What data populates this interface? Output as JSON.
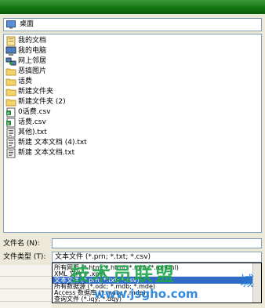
{
  "look_in": {
    "value": "桌面",
    "icon": "desktop-icon"
  },
  "files": [
    {
      "label": "我的文档",
      "icon": "my-documents-icon"
    },
    {
      "label": "我的电脑",
      "icon": "my-computer-icon"
    },
    {
      "label": "网上邻居",
      "icon": "network-icon"
    },
    {
      "label": "恶搞图片",
      "icon": "folder-icon"
    },
    {
      "label": "话费",
      "icon": "folder-icon"
    },
    {
      "label": "新建文件夹",
      "icon": "folder-icon"
    },
    {
      "label": "新建文件夹 (2)",
      "icon": "folder-icon"
    },
    {
      "label": "0话费.csv",
      "icon": "excel-file-icon"
    },
    {
      "label": "话费.csv",
      "icon": "excel-file-icon"
    },
    {
      "label": "其他).txt",
      "icon": "text-file-icon"
    },
    {
      "label": "新建 文本文档 (4).txt",
      "icon": "text-file-icon"
    },
    {
      "label": "新建 文本文档.txt",
      "icon": "text-file-icon"
    }
  ],
  "filename": {
    "label": "文件名 (N):",
    "value": ""
  },
  "filetype": {
    "label": "文件类型 (T):",
    "value": "文本文件 (*.prn; *.txt; *.csv)",
    "options": [
      "所有网页 (*.htm; *.html; *.mht; *.mhtml)",
      "XML 文件 (*.xml)",
      "文本文件 (*.prn; *.txt; *.csv)",
      "所有数据源 (*.odc; *.mdb; *.mde)",
      "Access 数据库 (*.mdb; *.mde)",
      "查询文件 (*.iqy; *.dqy)"
    ],
    "selected_index": 2
  },
  "watermark": {
    "main": "技术员联盟",
    "url": "www.jsgho.com",
    "side": "城"
  },
  "colors": {
    "titlebar": "#127712",
    "selection": "#316ac5",
    "watermark_green": "#1ea64a",
    "watermark_blue": "#1e7fd8"
  }
}
